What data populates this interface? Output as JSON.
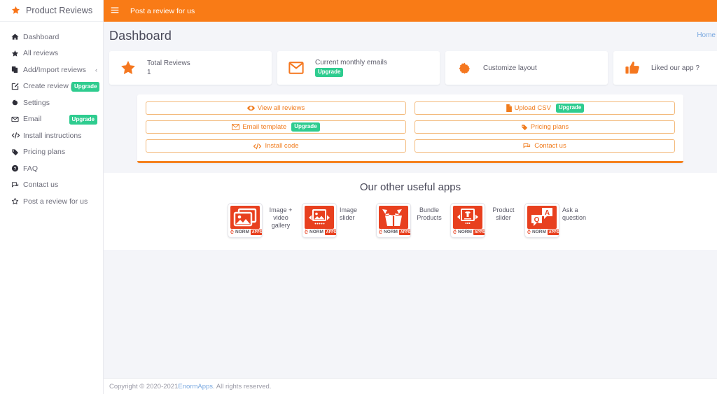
{
  "brand": {
    "title": "Product Reviews",
    "icon": "star-icon"
  },
  "sidebar": {
    "items": [
      {
        "label": "Dashboard",
        "icon": "home-icon"
      },
      {
        "label": "All reviews",
        "icon": "star-filled-icon"
      },
      {
        "label": "Add/Import reviews",
        "icon": "clone-icon",
        "chevron": "‹"
      },
      {
        "label": "Create review pa",
        "icon": "pen-square-icon",
        "badge": "Upgrade"
      },
      {
        "label": "Settings",
        "icon": "gear-icon"
      },
      {
        "label": "Email",
        "icon": "envelope-icon",
        "badge": "Upgrade"
      },
      {
        "label": "Install instructions",
        "icon": "code-icon"
      },
      {
        "label": "Pricing plans",
        "icon": "tag-icon"
      },
      {
        "label": "FAQ",
        "icon": "question-circle-icon"
      },
      {
        "label": "Contact us",
        "icon": "comments-icon"
      },
      {
        "label": "Post a review for us",
        "icon": "star-outline-icon"
      }
    ]
  },
  "topbar": {
    "menu_icon": "hamburger-icon",
    "link": "Post a review for us"
  },
  "page": {
    "title": "Dashboard",
    "breadcrumb": "Home"
  },
  "stats": [
    {
      "icon": "star-icon",
      "label": "Total Reviews",
      "value": "1",
      "badge": ""
    },
    {
      "icon": "envelope-icon",
      "label": "Current monthly emails",
      "value": "",
      "badge": "Upgrade"
    },
    {
      "icon": "gear-icon",
      "label": "Customize layout",
      "value": "",
      "badge": ""
    },
    {
      "icon": "thumbs-up-icon",
      "label": "Liked our app ?",
      "value": "",
      "badge": ""
    }
  ],
  "actions": [
    {
      "label": "View all reviews",
      "icon": "eye-icon",
      "badge": ""
    },
    {
      "label": "Upload CSV",
      "icon": "file-icon",
      "badge": "Upgrade"
    },
    {
      "label": "Email template",
      "icon": "envelope-icon",
      "badge": "Upgrade"
    },
    {
      "label": "Pricing plans",
      "icon": "tag-icon",
      "badge": ""
    },
    {
      "label": "Install code",
      "icon": "code-icon",
      "badge": ""
    },
    {
      "label": "Contact us",
      "icon": "comments-icon",
      "badge": ""
    }
  ],
  "apps": {
    "title": "Our other useful apps",
    "brand_word": "NORM",
    "brand_suffix": "APPS",
    "items": [
      {
        "label": "Image + video gallery",
        "icon": "gallery-icon"
      },
      {
        "label": "Image slider",
        "icon": "image-slider-icon"
      },
      {
        "label": "Bundle Products",
        "icon": "open-box-icon"
      },
      {
        "label": "Product slider",
        "icon": "product-slider-icon"
      },
      {
        "label": "Ask a question",
        "icon": "qa-bubbles-icon"
      }
    ]
  },
  "footer": {
    "pre": "Copyright © 2020-2021 ",
    "link": "EnormApps",
    "post": ". All rights reserved."
  },
  "colors": {
    "accent": "#f97b16",
    "badge_green": "#2ecc8f",
    "app_red": "#e8401f",
    "link_blue": "#7aa9e0"
  }
}
